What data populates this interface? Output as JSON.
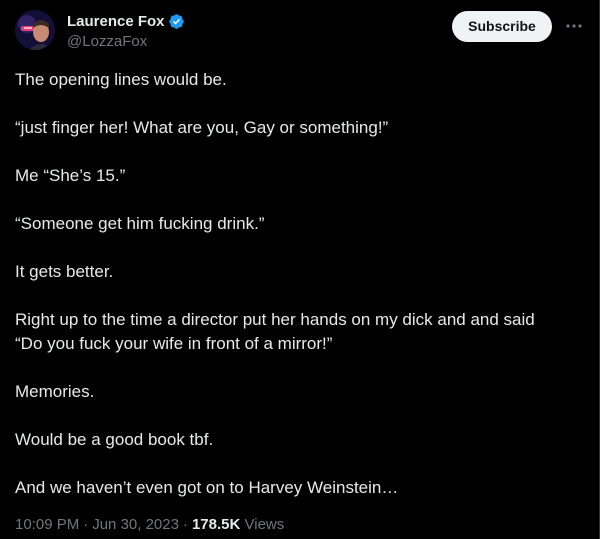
{
  "author": {
    "display_name": "Laurence Fox",
    "handle": "@LozzaFox",
    "verified": true,
    "verified_color": "#1d9bf0"
  },
  "actions": {
    "subscribe_label": "Subscribe",
    "more_icon": "more-horizontal-icon"
  },
  "tweet": {
    "paragraphs": [
      "The opening lines would be.",
      "“just finger her! What are you, Gay or something!”",
      "Me “She’s 15.”",
      "“Someone get him fucking drink.”",
      "It gets better.",
      "Right up to the time a director put her hands on my dick and and said\n“Do you fuck your wife in front of a mirror!”",
      "Memories.",
      "Would be a good book tbf.",
      "And we haven’t even got on to Harvey Weinstein…"
    ]
  },
  "meta": {
    "time": "10:09 PM",
    "date": "Jun 30, 2023",
    "separator": "·",
    "views_count": "178.5K",
    "views_label": "Views"
  },
  "colors": {
    "background": "#000000",
    "text": "#e7e9ea",
    "secondary_text": "#71767b",
    "subscribe_bg": "#eff3f4"
  }
}
